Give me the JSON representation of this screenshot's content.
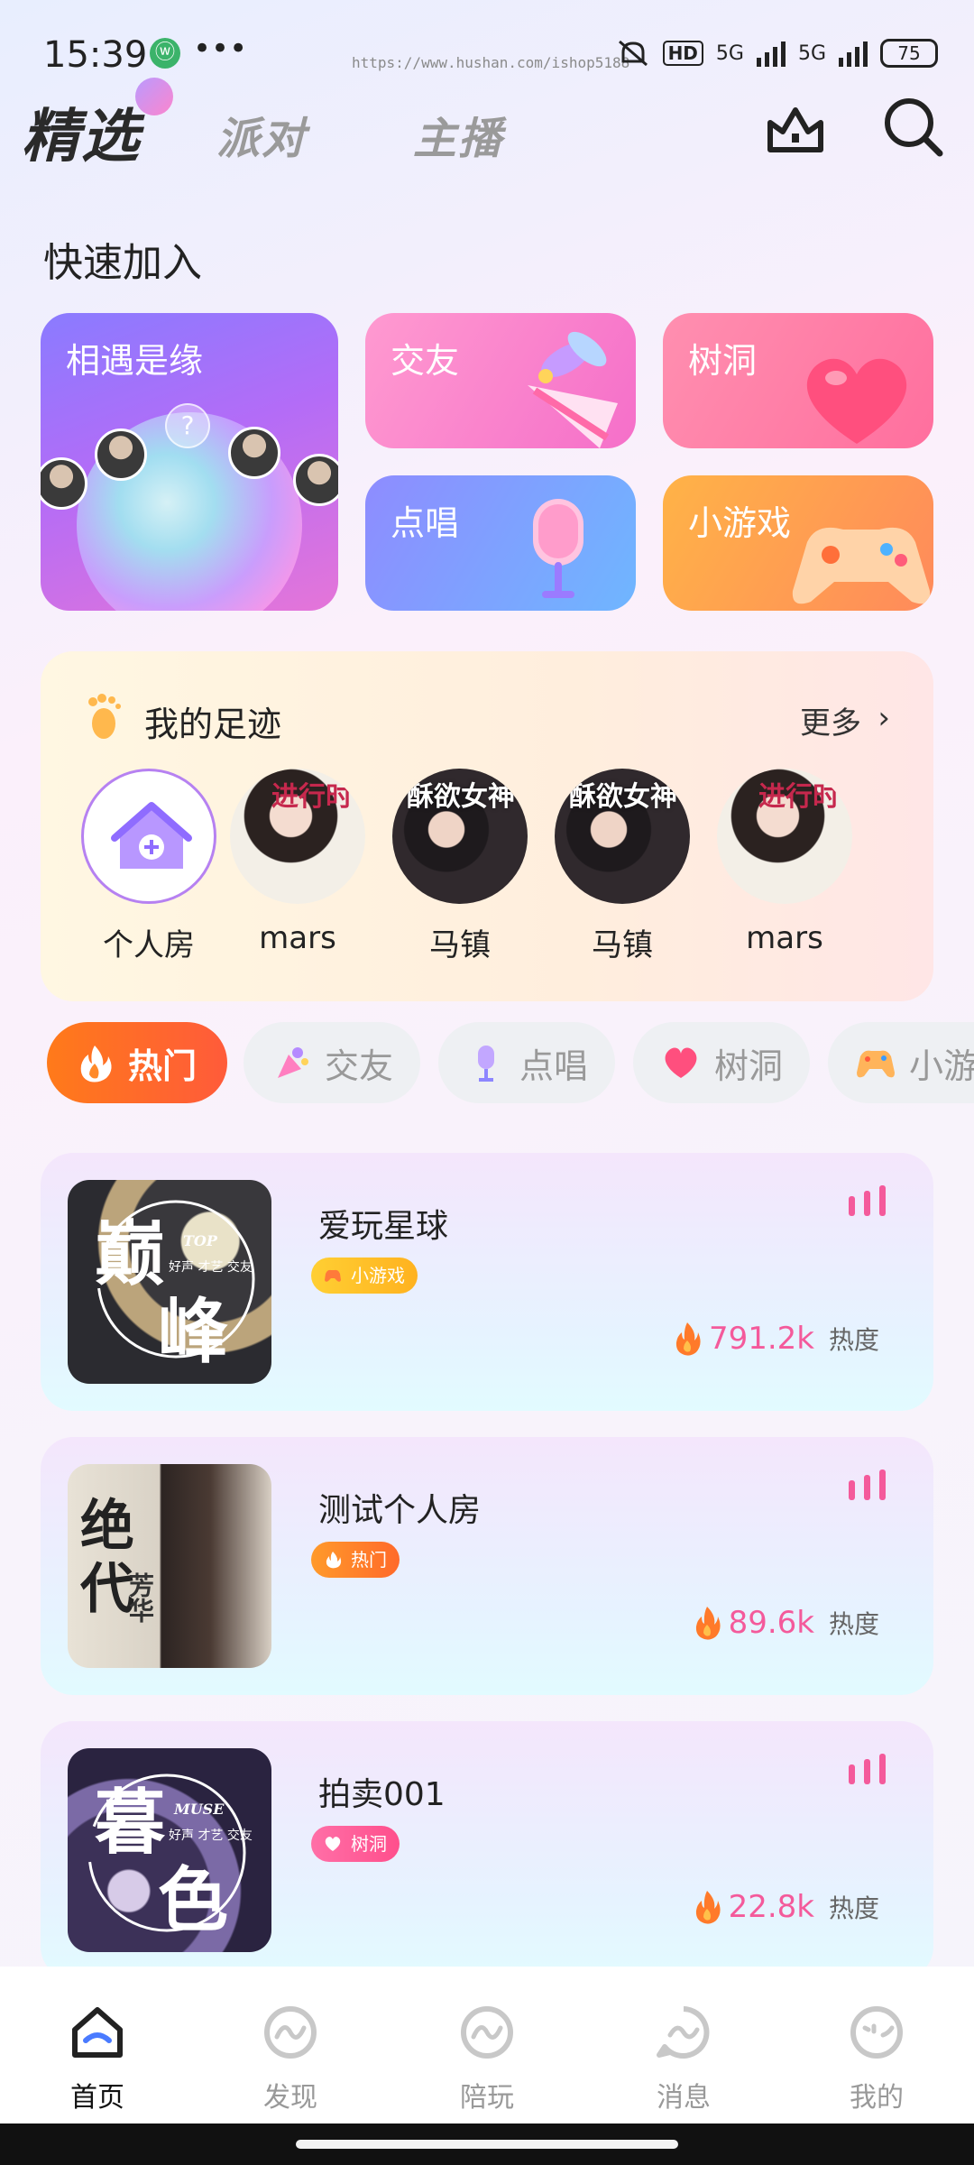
{
  "status": {
    "time": "15:39",
    "app_icon": "ⓦ",
    "dots": "•••",
    "url": "https://www.hushan.com/ishop5188",
    "hd": "HD",
    "net1": "5G",
    "net2": "5G",
    "battery": "75"
  },
  "topnav": {
    "tabs": [
      "精选",
      "派对",
      "主播"
    ],
    "active_tab": "精选",
    "icons": [
      "crown-icon",
      "search-icon"
    ]
  },
  "quick_join": {
    "title": "快速加入",
    "cards": [
      {
        "label": "相遇是缘",
        "icon": "bubble-match"
      },
      {
        "label": "交友",
        "icon": "party-popper"
      },
      {
        "label": "树洞",
        "icon": "heart"
      },
      {
        "label": "点唱",
        "icon": "microphone"
      },
      {
        "label": "小游戏",
        "icon": "gamepad"
      }
    ],
    "match_question": "?"
  },
  "footprint": {
    "title": "我的足迹",
    "more": "更多",
    "chevron": "›",
    "items": [
      {
        "name": "个人房",
        "avatar": "home-plus-icon"
      },
      {
        "name": "mars",
        "avatar_text": "进行时"
      },
      {
        "name": "马镇",
        "avatar_text": "酥欲女神"
      },
      {
        "name": "马镇",
        "avatar_text": "酥欲女神"
      },
      {
        "name": "mars",
        "avatar_text": "进行时"
      }
    ]
  },
  "categories": [
    {
      "label": "热门",
      "icon": "fire-icon",
      "active": true
    },
    {
      "label": "交友",
      "icon": "party-icon",
      "active": false
    },
    {
      "label": "点唱",
      "icon": "mic-icon",
      "active": false
    },
    {
      "label": "树洞",
      "icon": "heart-icon",
      "active": false
    },
    {
      "label": "小游戏",
      "icon": "gamepad-icon",
      "active": false
    }
  ],
  "rooms": [
    {
      "title": "爱玩星球",
      "tag": "小游戏",
      "heat": "791.2k",
      "heat_unit": "热度",
      "cover_text": [
        "巅",
        "峰"
      ],
      "cover_sub": "TOP",
      "cover_caption": "好声 才艺 交友"
    },
    {
      "title": "测试个人房",
      "tag": "热门",
      "heat": "89.6k",
      "heat_unit": "热度",
      "cover_text": [
        "绝",
        "代"
      ],
      "cover_sub": "芳华",
      "cover_caption": ""
    },
    {
      "title": "拍卖001",
      "tag": "树洞",
      "heat": "22.8k",
      "heat_unit": "热度",
      "cover_text": [
        "暮",
        "色"
      ],
      "cover_sub": "MUSE",
      "cover_caption": "好声 才艺 交友"
    }
  ],
  "bottomnav": [
    {
      "label": "首页",
      "icon": "home-icon",
      "active": true
    },
    {
      "label": "发现",
      "icon": "discover-icon",
      "active": false
    },
    {
      "label": "陪玩",
      "icon": "playmate-icon",
      "active": false
    },
    {
      "label": "消息",
      "icon": "message-icon",
      "active": false
    },
    {
      "label": "我的",
      "icon": "profile-icon",
      "active": false
    }
  ],
  "colors": {
    "accent_pink": "#f45a9b",
    "hot_orange": "#ff6a2a",
    "active_text": "#111111",
    "inactive_text": "#999999"
  }
}
